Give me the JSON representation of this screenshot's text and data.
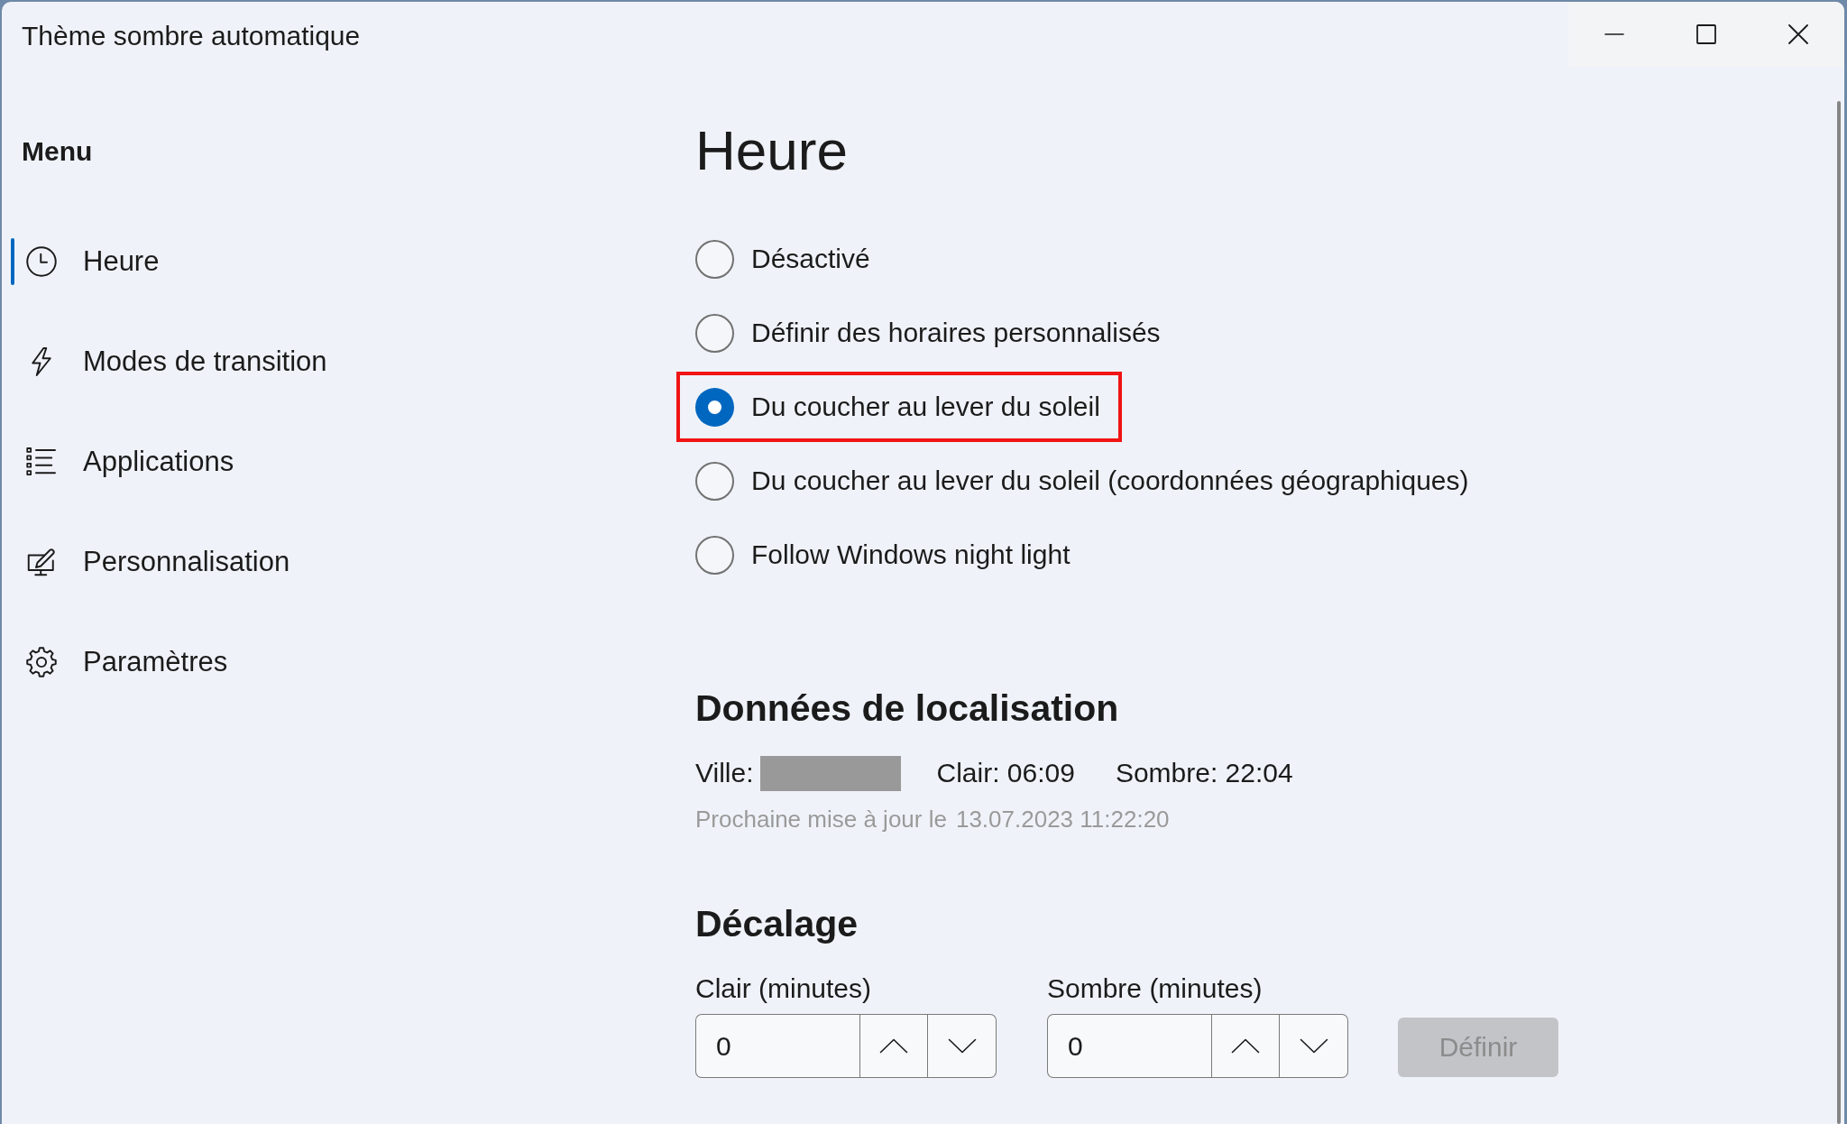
{
  "window": {
    "title": "Thème sombre automatique"
  },
  "sidebar": {
    "heading": "Menu",
    "items": [
      {
        "label": "Heure",
        "selected": true
      },
      {
        "label": "Modes de transition",
        "selected": false
      },
      {
        "label": "Applications",
        "selected": false
      },
      {
        "label": "Personnalisation",
        "selected": false
      },
      {
        "label": "Paramètres",
        "selected": false
      }
    ]
  },
  "page": {
    "title": "Heure",
    "options": [
      {
        "label": "Désactivé",
        "selected": false,
        "highlighted": false
      },
      {
        "label": "Définir des horaires personnalisés",
        "selected": false,
        "highlighted": false
      },
      {
        "label": "Du coucher au lever du soleil",
        "selected": true,
        "highlighted": true
      },
      {
        "label": "Du coucher au lever du soleil (coordonnées géographiques)",
        "selected": false,
        "highlighted": false
      },
      {
        "label": "Follow Windows night light",
        "selected": false,
        "highlighted": false
      }
    ]
  },
  "location": {
    "heading": "Données de localisation",
    "city_label": "Ville:",
    "city_value": {
      "kind": "redacted"
    },
    "light": "Clair: 06:09",
    "dark": "Sombre: 22:04",
    "next_update_label": "Prochaine mise à jour le",
    "next_update": "13.07.2023 11:22:20"
  },
  "offset": {
    "heading": "Décalage",
    "fields": [
      {
        "label": "Clair (minutes)",
        "value": "0"
      },
      {
        "label": "Sombre (minutes)",
        "value": "0"
      }
    ],
    "button": {
      "label": "Définir",
      "disabled": true
    }
  }
}
